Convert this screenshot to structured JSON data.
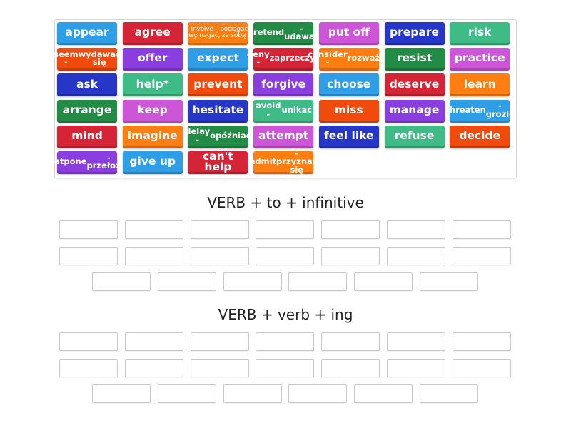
{
  "colors": {
    "blue": "#2e9fe6",
    "red": "#d42436",
    "orange": "#ff7e12",
    "darkgreen": "#228b45",
    "magenta": "#cc55d8",
    "navy": "#2536c8",
    "teal": "#3ebb86",
    "redorange": "#f04b0c",
    "purple": "#8a3ee0"
  },
  "tiles": [
    {
      "label": "appear",
      "color": "blue",
      "size": "big"
    },
    {
      "label": "agree",
      "color": "red",
      "size": "big"
    },
    {
      "label": "involve - wymagać, pociągać za sobą",
      "color": "orange",
      "size": "small"
    },
    {
      "label": "pretend - udawać",
      "color": "darkgreen",
      "size": "mid"
    },
    {
      "label": "put off",
      "color": "magenta",
      "size": "big"
    },
    {
      "label": "prepare",
      "color": "navy",
      "size": "big"
    },
    {
      "label": "risk",
      "color": "teal",
      "size": "big"
    },
    {
      "label": "seem - wydawać się",
      "color": "redorange",
      "size": "mid"
    },
    {
      "label": "offer",
      "color": "purple",
      "size": "big"
    },
    {
      "label": "expect",
      "color": "blue",
      "size": "big"
    },
    {
      "label": "deny - zaprzeczyć",
      "color": "red",
      "size": "mid"
    },
    {
      "label": "consider - rozważyć",
      "color": "orange",
      "size": "mid"
    },
    {
      "label": "resist",
      "color": "darkgreen",
      "size": "big"
    },
    {
      "label": "practice",
      "color": "magenta",
      "size": "big"
    },
    {
      "label": "ask",
      "color": "navy",
      "size": "big"
    },
    {
      "label": "help*",
      "color": "teal",
      "size": "big"
    },
    {
      "label": "prevent",
      "color": "redorange",
      "size": "big"
    },
    {
      "label": "forgive",
      "color": "purple",
      "size": "big"
    },
    {
      "label": "choose",
      "color": "blue",
      "size": "big"
    },
    {
      "label": "deserve",
      "color": "red",
      "size": "big"
    },
    {
      "label": "learn",
      "color": "orange",
      "size": "big"
    },
    {
      "label": "arrange",
      "color": "darkgreen",
      "size": "big"
    },
    {
      "label": "keep",
      "color": "magenta",
      "size": "big"
    },
    {
      "label": "hesitate",
      "color": "navy",
      "size": "big"
    },
    {
      "label": "avoid - unikać",
      "color": "teal",
      "size": "mid"
    },
    {
      "label": "miss",
      "color": "redorange",
      "size": "big"
    },
    {
      "label": "manage",
      "color": "purple",
      "size": "big"
    },
    {
      "label": "threaten - grozić",
      "color": "blue",
      "size": "mid"
    },
    {
      "label": "mind",
      "color": "red",
      "size": "big"
    },
    {
      "label": "imagine",
      "color": "orange",
      "size": "big"
    },
    {
      "label": "delay - opóźniać",
      "color": "darkgreen",
      "size": "mid"
    },
    {
      "label": "attempt",
      "color": "magenta",
      "size": "big"
    },
    {
      "label": "feel like",
      "color": "navy",
      "size": "big"
    },
    {
      "label": "refuse",
      "color": "teal",
      "size": "big"
    },
    {
      "label": "decide",
      "color": "redorange",
      "size": "big"
    },
    {
      "label": "postpone - przełożyć",
      "color": "purple",
      "size": "mid"
    },
    {
      "label": "give up",
      "color": "blue",
      "size": "big"
    },
    {
      "label": "can't help",
      "color": "red",
      "size": "big"
    },
    {
      "label": "admit -przyznać się",
      "color": "orange",
      "size": "mid"
    }
  ],
  "tile_lines": {
    "2": [
      "involve - wymagać,",
      "pociągać za sobą"
    ],
    "3": [
      "pretend",
      "- udawać"
    ],
    "7": [
      "seem -",
      "wydawać się"
    ],
    "10": [
      "deny -",
      "zaprzeczyć"
    ],
    "11": [
      "consider -",
      "rozważyć"
    ],
    "24": [
      "avoid -",
      "unikać"
    ],
    "27": [
      "threaten",
      "- grozić"
    ],
    "30": [
      "delay -",
      "opóźniać"
    ],
    "35": [
      "postpone",
      "- przełożyć"
    ],
    "38": [
      "admit",
      "-przyznać się"
    ]
  },
  "groups": [
    {
      "title": "VERB + to + infinitive",
      "slots": 20
    },
    {
      "title": "VERB + verb + ing",
      "slots": 20
    }
  ]
}
